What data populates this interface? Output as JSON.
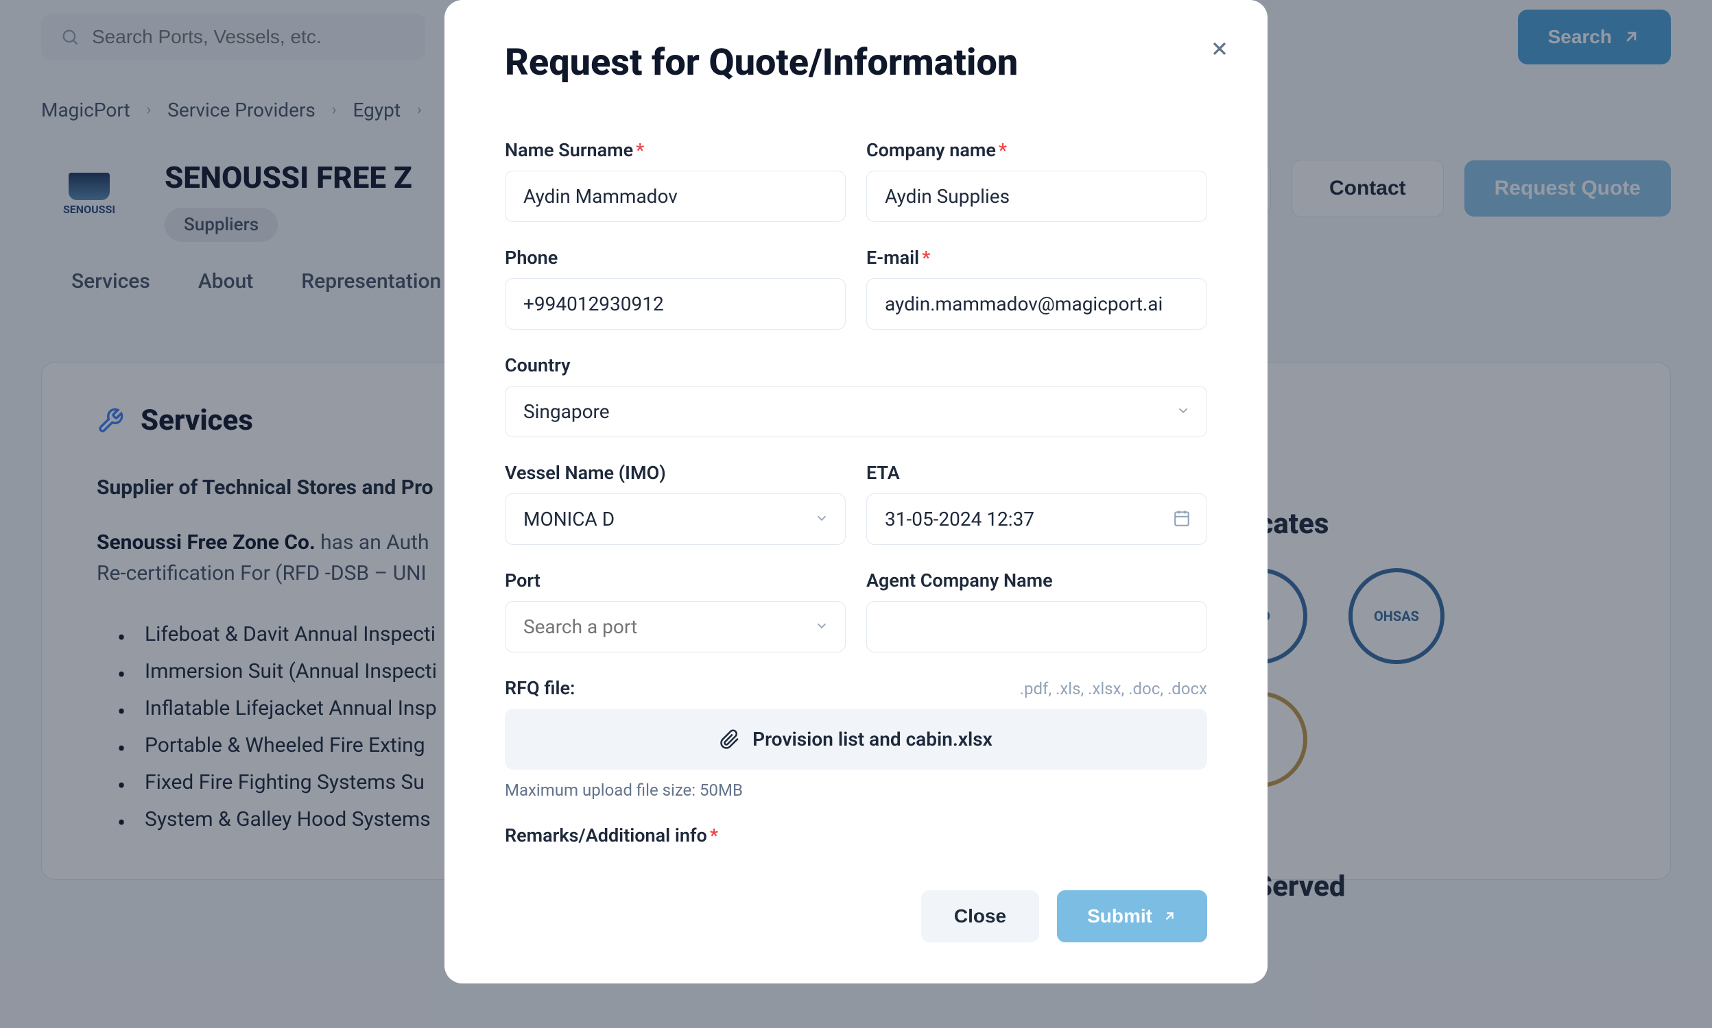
{
  "search": {
    "placeholder": "Search Ports, Vessels, etc.",
    "button": "Search"
  },
  "breadcrumb": {
    "items": [
      "MagicPort",
      "Service Providers",
      "Egypt"
    ]
  },
  "company": {
    "name": "SENOUSSI FREE Z",
    "logo_text": "SENOUSSI",
    "tag": "Suppliers",
    "contact_btn": "Contact",
    "request_btn": "Request Quote"
  },
  "tabs": [
    "Services",
    "About",
    "Representation"
  ],
  "services": {
    "heading": "Services",
    "subtitle": "Supplier of Technical Stores and Pro",
    "company_strong": "Senoussi Free Zone Co.",
    "para_rest": " has an Auth",
    "para_line2": "Re-certification For (RFD -DSB – UNI",
    "bullets": [
      "Lifeboat & Davit Annual Inspecti",
      "Immersion Suit (Annual Inspecti",
      "Inflatable Lifejacket Annual Insp",
      "Portable & Wheeled Fire Exting",
      "Fixed Fire Fighting Systems Su",
      "System & Galley Hood Systems"
    ]
  },
  "side": {
    "certs_title": "rtificates",
    "ports_title": "rts Served",
    "cert1": "ISO",
    "cert2": "OHSAS"
  },
  "modal": {
    "title": "Request for Quote/Information",
    "labels": {
      "name": "Name Surname",
      "company": "Company name",
      "phone": "Phone",
      "email": "E-mail",
      "country": "Country",
      "vessel": "Vessel Name (IMO)",
      "eta": "ETA",
      "port": "Port",
      "agent": "Agent Company Name",
      "rfq": "RFQ file:",
      "remarks": "Remarks/Additional info"
    },
    "values": {
      "name": "Aydin Mammadov",
      "company": "Aydin Supplies",
      "phone": "+994012930912",
      "email": "aydin.mammadov@magicport.ai",
      "country": "Singapore",
      "vessel": "MONICA D",
      "eta": "31-05-2024 12:37",
      "port_placeholder": "Search a port",
      "agent": ""
    },
    "file_hint": ".pdf, .xls, .xlsx, .doc, .docx",
    "file_name": "Provision list and cabin.xlsx",
    "file_meta": "Maximum upload file size: 50MB",
    "buttons": {
      "close": "Close",
      "submit": "Submit"
    }
  }
}
